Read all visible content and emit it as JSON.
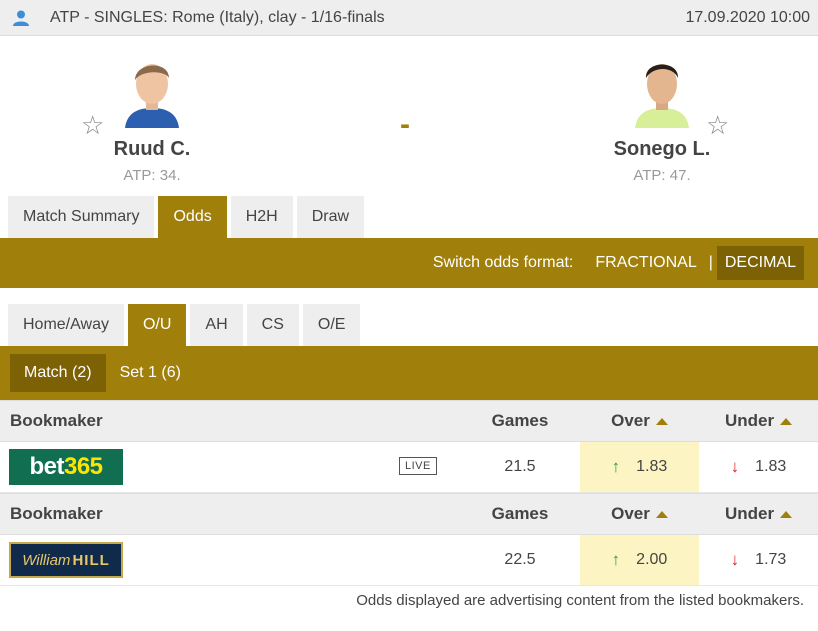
{
  "header": {
    "title": "ATP - SINGLES: Rome (Italy), clay - 1/16-finals",
    "datetime": "17.09.2020 10:00"
  },
  "match": {
    "score": "-",
    "home": {
      "name": "Ruud C.",
      "rank": "ATP: 34."
    },
    "away": {
      "name": "Sonego L.",
      "rank": "ATP: 47."
    }
  },
  "tabs": [
    "Match Summary",
    "Odds",
    "H2H",
    "Draw"
  ],
  "odds_format": {
    "label": "Switch odds format:",
    "fractional": "FRACTIONAL",
    "separator": "|",
    "decimal": "DECIMAL"
  },
  "subtabs": [
    "Home/Away",
    "O/U",
    "AH",
    "CS",
    "O/E"
  ],
  "periods": [
    "Match (2)",
    "Set 1 (6)"
  ],
  "table": {
    "headers": {
      "bookmaker": "Bookmaker",
      "games": "Games",
      "over": "Over",
      "under": "Under"
    },
    "rows": [
      {
        "bookmaker": "bet365",
        "logo_text_a": "bet",
        "logo_text_b": "365",
        "live": "LIVE",
        "games": "21.5",
        "over": "1.83",
        "under": "1.83"
      },
      {
        "bookmaker": "William Hill",
        "logo_text_a": "William",
        "logo_text_b": "HILL",
        "live": "",
        "games": "22.5",
        "over": "2.00",
        "under": "1.73"
      }
    ]
  },
  "disclaimer": "Odds displayed are advertising content from the listed bookmakers.",
  "colors": {
    "accent": "#a07f0a",
    "accent_dark": "#7c6205",
    "highlight": "#fcf4c2"
  }
}
